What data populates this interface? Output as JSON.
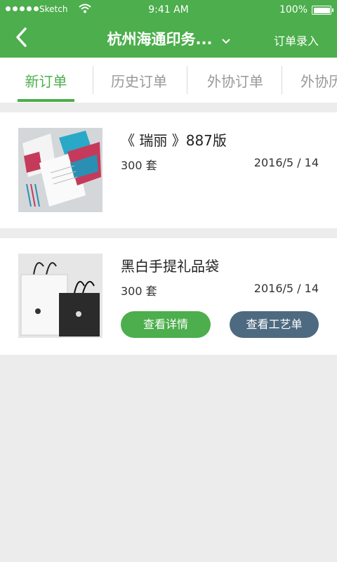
{
  "status_bar": {
    "carrier": "Sketch",
    "time": "9:41 AM",
    "battery": "100%"
  },
  "header": {
    "title": "杭州海通印务...",
    "action": "订单录入"
  },
  "tabs": [
    {
      "label": "新订单",
      "active": true
    },
    {
      "label": "历史订单",
      "active": false
    },
    {
      "label": "外协订单",
      "active": false
    },
    {
      "label": "外协历",
      "active": false
    }
  ],
  "orders": [
    {
      "name": "《 瑞丽 》887版",
      "quantity": "300 套",
      "date": "2016/5 / 14"
    },
    {
      "name": "黑白手提礼品袋",
      "quantity": "300 套",
      "date": "2016/5 / 14",
      "detail_button": "查看详情",
      "craft_button": "查看工艺单"
    }
  ],
  "colors": {
    "brand_green": "#4cae4c",
    "slate_button": "#4e6a80",
    "page_background": "#ececec"
  }
}
